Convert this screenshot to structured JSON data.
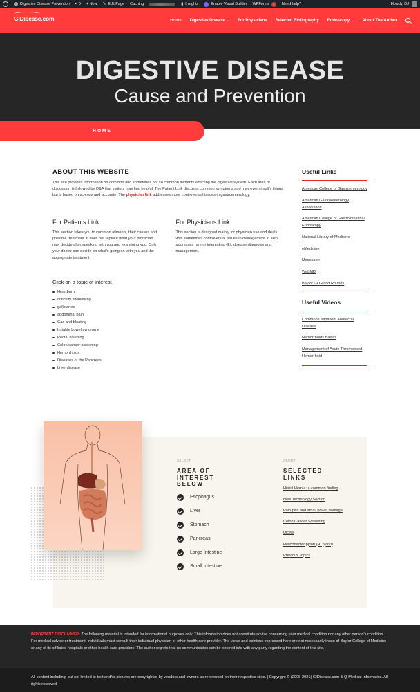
{
  "admin_bar": {
    "site_name": "Digestive Disease Prevention",
    "comments_count": "0",
    "new_label": "+ New",
    "edit_page": "Edit Page",
    "caching": "Caching",
    "insights": "Insights",
    "visual_builder": "Enable Visual Builder",
    "wpforms": "WPForms",
    "wpforms_badge": "1",
    "need_help": "Need help?",
    "user_greeting": "Howdy, DJ"
  },
  "header": {
    "logo_text": "GIDisease.com",
    "nav": [
      {
        "label": "Home",
        "active": true,
        "has_dropdown": false
      },
      {
        "label": "Digestive Disease",
        "active": false,
        "has_dropdown": true
      },
      {
        "label": "For Physicians",
        "active": false,
        "has_dropdown": false
      },
      {
        "label": "Selected Bibliography",
        "active": false,
        "has_dropdown": false
      },
      {
        "label": "Endoscopy",
        "active": false,
        "has_dropdown": true
      },
      {
        "label": "About The Author",
        "active": false,
        "has_dropdown": false
      }
    ]
  },
  "hero": {
    "title": "DIGESTIVE DISEASE",
    "subtitle": "Cause and Prevention",
    "breadcrumb": "HOME"
  },
  "about": {
    "heading": "ABOUT THIS WEBSITE",
    "body_pre": "This site provides information on common and sometimes not so common ailments affecting the digestive system. Each area of discussion is followed by Q&A that visitors may find helpful. The Patient Link discuses common symptoms and may over simplify things but is based on science and accurate. The ",
    "body_link": "physician link",
    "body_post": " addresses more controversial issues in gastroenterology."
  },
  "patients": {
    "heading": "For Patients Link",
    "body": "This section takes you to common ailments, their causes and possible treatment. It does not replace what your physician may decide after speaking with you and examining you. Only your doctor can decide on what's going on with you and the appropriate treatment."
  },
  "physicians": {
    "heading": "For Physicians Link",
    "body": "This section is designed mainly for physician use and deals with sometimes controversial issues in management. It also addresses rare or interesting G.I. disease diagnosis and management."
  },
  "topics": {
    "heading": "Click on a topic of interest",
    "items": [
      "Heartburn",
      "difficulty swallowing",
      "gallstones",
      "abdominal pain",
      "Gas and bloating",
      "Irritable bowel syndrome",
      "Rectal bleeding",
      "Colon cancer screening",
      "Hemorrhoids",
      "Diseases of the Pancreas",
      "Liver disease"
    ]
  },
  "sidebar": {
    "useful_links_heading": "Useful Links",
    "useful_links": [
      "American College of Gastroenterology",
      "American Gastroenterology Association",
      "American College of Gastrointestinal Endoscopy",
      "National Library of Medicine",
      "eMedicine",
      "Medscape",
      "WebMD",
      "Baylor GI Grand Rounds"
    ],
    "useful_videos_heading": "Useful Videos",
    "useful_videos": [
      "Common Outpatient Anorectal Disease",
      "Hemorrhoids Basics",
      "Management of Acute Thrombosed Hemorrhoid"
    ]
  },
  "feature": {
    "select_eyebrow": "SELECT",
    "select_heading": "AREA OF INTEREST BELOW",
    "areas": [
      "Esophagus",
      "Liver",
      "Stomach",
      "Pancreas",
      "Large Intestine",
      "Small Intestine"
    ],
    "about_eyebrow": "ABOUT",
    "about_heading": "SELECTED LINKS",
    "links": [
      "Hiatal Hernia: a common finding",
      "New Technology Section",
      "Pain pills and small bowel damage",
      "Colon Cancer Screening",
      "Ulcers",
      "Helicobacter pylori (H. pylori)",
      "Previous Topics"
    ]
  },
  "footer": {
    "disclaimer_label": "IMPORTANT DISCLAIMER:",
    "disclaimer_text": " The following material is intended for informational purposes only. This information does not constitute advise concerning your medical condition nor any other person's condition. For medical advice or treatment, individuals must consult their individual physician or other health care provider. The views and opinions expressed here are not necessarily those of Baylor College of Medicine or any of its affiliated hospitals or other health care providers. The author regrets that no communication can be entered into with any party regarding the content of this site.",
    "copyright": "All content including, but not limited to text and/or pictures are copyrighted by vendors and owners as referenced on their respective sites. | Copyright © (2005-2021) GIDisease.com & Q-Medical Informatics. All rights reserved."
  },
  "colors": {
    "brand_red": "#ff3b3b",
    "dark": "#262626",
    "link_red": "#e02b20",
    "feature_bg": "#f8f5ee"
  }
}
